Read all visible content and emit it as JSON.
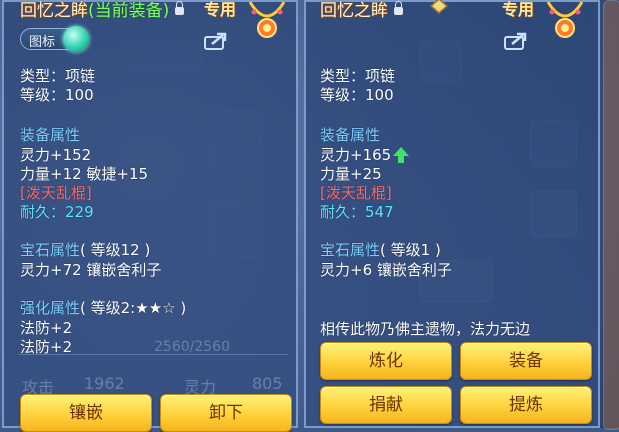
{
  "left": {
    "title": "回忆之眸",
    "title_suffix": "(当前装备)",
    "exclusive_tag": "专用",
    "toggle_label": "图标",
    "type_line": "类型：项链",
    "level_line": "等级：100",
    "equip_attr_header": "装备属性",
    "attr_lines": [
      "灵力+152",
      "力量+12 敏捷+15"
    ],
    "special": "[泼天乱棍]",
    "durability": "耐久：229",
    "gem_header": "宝石属性",
    "gem_level": "( 等级12 )",
    "gem_line": "灵力+72 镶嵌舍利子",
    "enhance_header": "强化属性",
    "enhance_level": "( 等级2:★★☆ )",
    "enhance_lines": [
      "法防+2",
      "法防+2"
    ],
    "bg_texts": [
      "2560/2560",
      "攻击",
      "1962",
      "灵力",
      "805"
    ],
    "buttons": [
      "镶嵌",
      "卸下"
    ]
  },
  "right": {
    "title": "回忆之眸",
    "exclusive_tag": "专用",
    "type_line": "类型：项链",
    "level_line": "等级：100",
    "equip_attr_header": "装备属性",
    "attr_lines": [
      "灵力+165",
      "力量+25"
    ],
    "special": "[泼天乱棍]",
    "durability": "耐久：547",
    "gem_header": "宝石属性",
    "gem_level": "( 等级1 )",
    "gem_line": "灵力+6 镶嵌舍利子",
    "description": "相传此物乃佛主遗物，法力无边",
    "buttons": [
      "炼化",
      "装备",
      "捐献",
      "提炼"
    ]
  },
  "colors": {
    "section": "#7fd0ff",
    "special": "#ff6a6a",
    "durability": "#5fe8ff",
    "button": "#ffd23c",
    "up_arrow": "#43e06a"
  },
  "icons": [
    "lock-icon",
    "necklace-icon",
    "share-icon",
    "up-arrow-icon"
  ]
}
